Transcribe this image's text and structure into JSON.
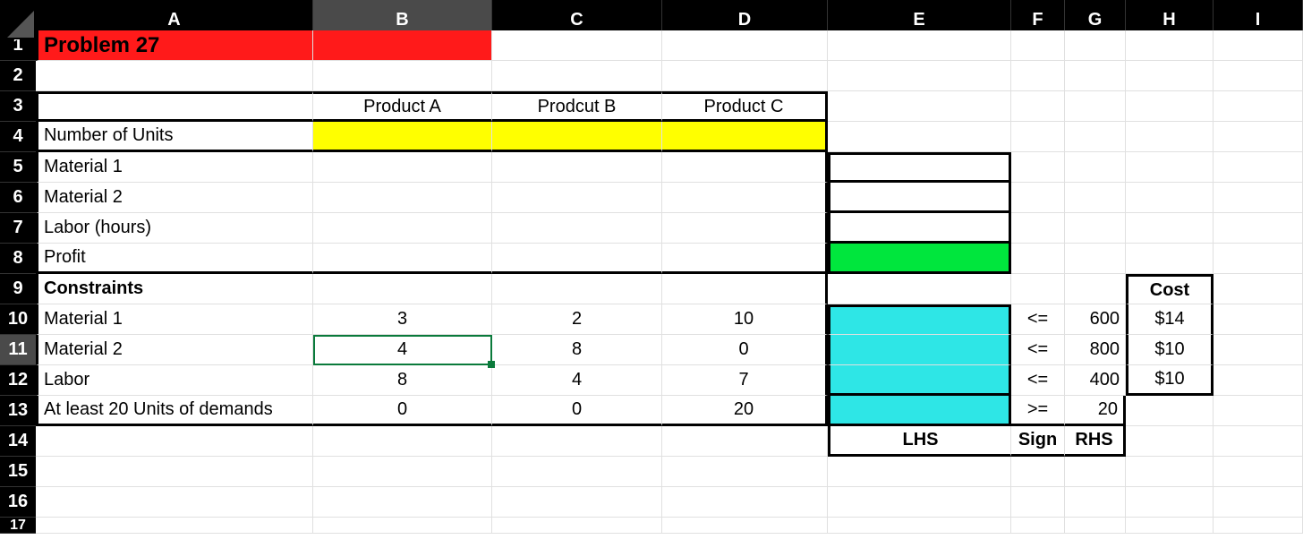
{
  "columns": [
    "A",
    "B",
    "C",
    "D",
    "E",
    "F",
    "G",
    "H",
    "I"
  ],
  "rows": [
    "1",
    "2",
    "3",
    "4",
    "5",
    "6",
    "7",
    "8",
    "9",
    "10",
    "11",
    "12",
    "13",
    "14",
    "15",
    "16",
    "17"
  ],
  "selected": {
    "col": "B",
    "row": "11"
  },
  "cells": {
    "A1": "Problem 27",
    "B3": "Product A",
    "C3": "Prodcut B",
    "D3": "Product C",
    "A4": "Number of Units",
    "A5": "Material 1",
    "A6": "Material 2",
    "A7": "Labor (hours)",
    "A8": "Profit",
    "A9": "Constraints",
    "A10": "Material 1",
    "A11": "Material 2",
    "A12": "Labor",
    "A13": "At least 20 Units of demands",
    "B10": "3",
    "C10": "2",
    "D10": "10",
    "B11": "4",
    "C11": "8",
    "D11": "0",
    "B12": "8",
    "C12": "4",
    "D12": "7",
    "B13": "0",
    "C13": "0",
    "D13": "20",
    "F10": "<=",
    "G10": "600",
    "H10": "$14",
    "F11": "<=",
    "G11": "800",
    "H11": "$10",
    "F12": "<=",
    "G12": "400",
    "H12": "$10",
    "F13": ">=",
    "G13": "20",
    "E14": "LHS",
    "F14": "Sign",
    "G14": "RHS",
    "H9": "Cost"
  }
}
